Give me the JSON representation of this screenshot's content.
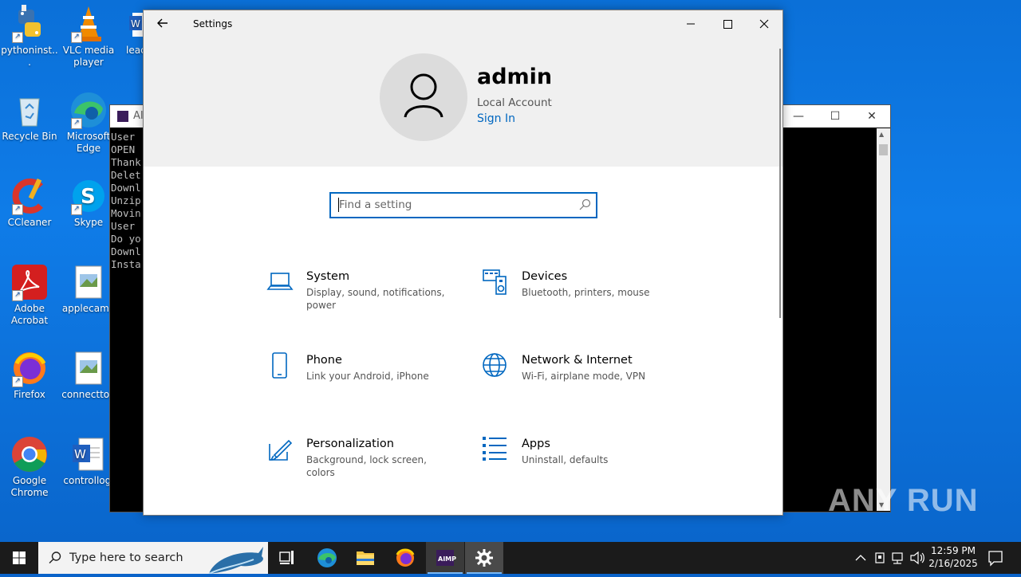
{
  "desktop": {
    "icons": [
      {
        "label": "pythoninst..."
      },
      {
        "label": "VLC media player"
      },
      {
        "label": "leac"
      },
      {
        "label": "Recycle Bin"
      },
      {
        "label": "Microsoft Edge"
      },
      {
        "label": "CCleaner"
      },
      {
        "label": "Skype"
      },
      {
        "label": "Adobe Acrobat"
      },
      {
        "label": "applecame"
      },
      {
        "label": "Firefox"
      },
      {
        "label": "connecttop"
      },
      {
        "label": "Google Chrome"
      },
      {
        "label": "controllogi"
      }
    ]
  },
  "console": {
    "title": "AI",
    "lines": [
      "User",
      "OPEN",
      "Thank",
      "Delet",
      "Downl",
      "Unzip",
      "Movin",
      "User",
      "Do yo",
      "Downl",
      "Insta"
    ]
  },
  "settings": {
    "title": "Settings",
    "user": {
      "name": "admin",
      "account": "Local Account",
      "signin": "Sign In"
    },
    "search_placeholder": "Find a setting",
    "categories": [
      {
        "title": "System",
        "desc": "Display, sound, notifications, power",
        "icon": "laptop-icon"
      },
      {
        "title": "Devices",
        "desc": "Bluetooth, printers, mouse",
        "icon": "devices-icon"
      },
      {
        "title": "Phone",
        "desc": "Link your Android, iPhone",
        "icon": "phone-icon"
      },
      {
        "title": "Network & Internet",
        "desc": "Wi-Fi, airplane mode, VPN",
        "icon": "globe-icon"
      },
      {
        "title": "Personalization",
        "desc": "Background, lock screen, colors",
        "icon": "brush-icon"
      },
      {
        "title": "Apps",
        "desc": "Uninstall, defaults",
        "icon": "apps-list-icon"
      }
    ]
  },
  "taskbar": {
    "search_placeholder": "Type here to search",
    "time": "12:59 PM",
    "date": "2/16/2025",
    "apps": [
      "task-view",
      "edge",
      "file-explorer",
      "firefox",
      "aimp",
      "settings"
    ]
  },
  "watermark": "ANY RUN",
  "colors": {
    "accent": "#0067c0",
    "desktop": "#0b70d8",
    "taskbar": "#1b1b1b"
  }
}
